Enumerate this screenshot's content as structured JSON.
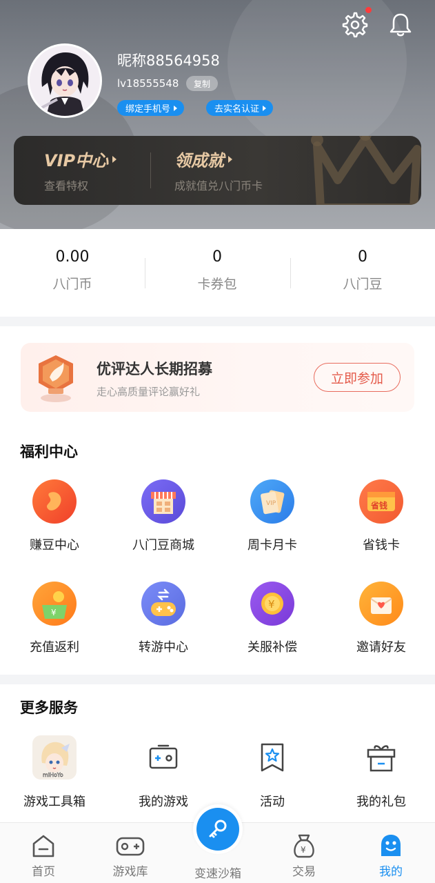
{
  "header": {
    "nickname": "昵称88564958",
    "uid": "lv18555548",
    "copy_label": "复制",
    "bind_phone_label": "绑定手机号",
    "real_name_label": "去实名认证"
  },
  "vip": {
    "vip_title": "VIP中心",
    "vip_sub": "查看特权",
    "achievement_title": "领成就",
    "achievement_sub": "成就值兑八门币卡"
  },
  "stats": [
    {
      "value": "0.00",
      "label": "八门币"
    },
    {
      "value": "0",
      "label": "卡券包"
    },
    {
      "value": "0",
      "label": "八门豆"
    }
  ],
  "banner": {
    "title": "优评达人长期招募",
    "subtitle": "走心高质量评论赢好礼",
    "button": "立即参加"
  },
  "welfare": {
    "title": "福利中心",
    "items": [
      {
        "label": "赚豆中心",
        "icon": "bean-icon"
      },
      {
        "label": "八门豆商城",
        "icon": "shop-icon"
      },
      {
        "label": "周卡月卡",
        "icon": "vip-card-icon"
      },
      {
        "label": "省钱卡",
        "icon": "save-money-card-icon"
      },
      {
        "label": "充值返利",
        "icon": "recharge-rebate-icon"
      },
      {
        "label": "转游中心",
        "icon": "game-transfer-icon"
      },
      {
        "label": "关服补偿",
        "icon": "coin-compensation-icon"
      },
      {
        "label": "邀请好友",
        "icon": "invite-envelope-icon"
      }
    ]
  },
  "more": {
    "title": "更多服务",
    "items": [
      {
        "label": "游戏工具箱",
        "icon": "game-toolbox-icon",
        "logo_text": "miHoYo"
      },
      {
        "label": "我的游戏",
        "icon": "my-games-icon"
      },
      {
        "label": "活动",
        "icon": "activity-icon"
      },
      {
        "label": "我的礼包",
        "icon": "gift-icon"
      }
    ]
  },
  "nav": {
    "items": [
      {
        "label": "首页",
        "icon": "home-icon"
      },
      {
        "label": "游戏库",
        "icon": "gamepad-icon"
      },
      {
        "label": "变速沙箱",
        "icon": "key-icon"
      },
      {
        "label": "交易",
        "icon": "money-bag-icon"
      },
      {
        "label": "我的",
        "icon": "profile-icon"
      }
    ],
    "active": "我的"
  },
  "colors": {
    "accent": "#1a8ff0",
    "vip_gold": "#e7c9a4",
    "banner_red": "#e45a4a",
    "notification_dot": "#ff3b3b"
  }
}
